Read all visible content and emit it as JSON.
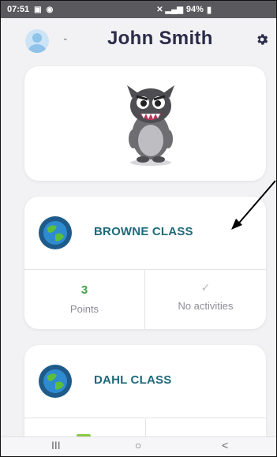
{
  "status_bar": {
    "time": "07:51",
    "battery": "94%"
  },
  "header": {
    "user_name": "John Smith"
  },
  "classes": [
    {
      "name": "BROWNE CLASS",
      "points_value": "3",
      "points_label": "Points",
      "activities_label": "No activities"
    },
    {
      "name": "DAHL CLASS"
    }
  ],
  "colors": {
    "class_name": "#1e6a7a",
    "points": "#3fa24a",
    "title": "#2b2b4a"
  },
  "icons": [
    "avatar-icon",
    "gear-icon",
    "globe-icon",
    "check-icon",
    "monster-avatar"
  ],
  "nav": {
    "recents": "III",
    "home": "○",
    "back": "<"
  }
}
